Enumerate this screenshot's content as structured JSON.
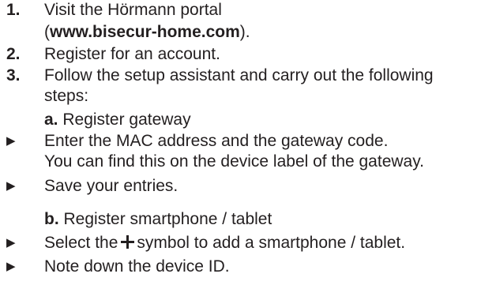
{
  "steps": [
    {
      "marker": "1.",
      "lines": [
        "Visit the Hörmann portal"
      ],
      "url_open": "(",
      "url": "www.bisecur-home.com",
      "url_close": ")."
    },
    {
      "marker": "2.",
      "text": "Register for an account."
    },
    {
      "marker": "3.",
      "lines": [
        "Follow the setup assistant and carry out the following",
        "steps:"
      ]
    }
  ],
  "substeps": {
    "a": {
      "marker": "a.",
      "text": "Register gateway"
    },
    "b": {
      "marker": "b.",
      "text": "Register smartphone / tablet"
    }
  },
  "actions": {
    "enter_mac": {
      "marker": "▶",
      "lines": [
        "Enter the MAC address and the gateway code.",
        "You can find this on the device label of the gateway."
      ]
    },
    "save": {
      "marker": "▶",
      "text": "Save your entries."
    },
    "select_plus": {
      "marker": "▶",
      "before": "Select the",
      "after": "symbol to add a smartphone / tablet."
    },
    "note_id": {
      "marker": "▶",
      "text": "Note down the device ID."
    }
  }
}
